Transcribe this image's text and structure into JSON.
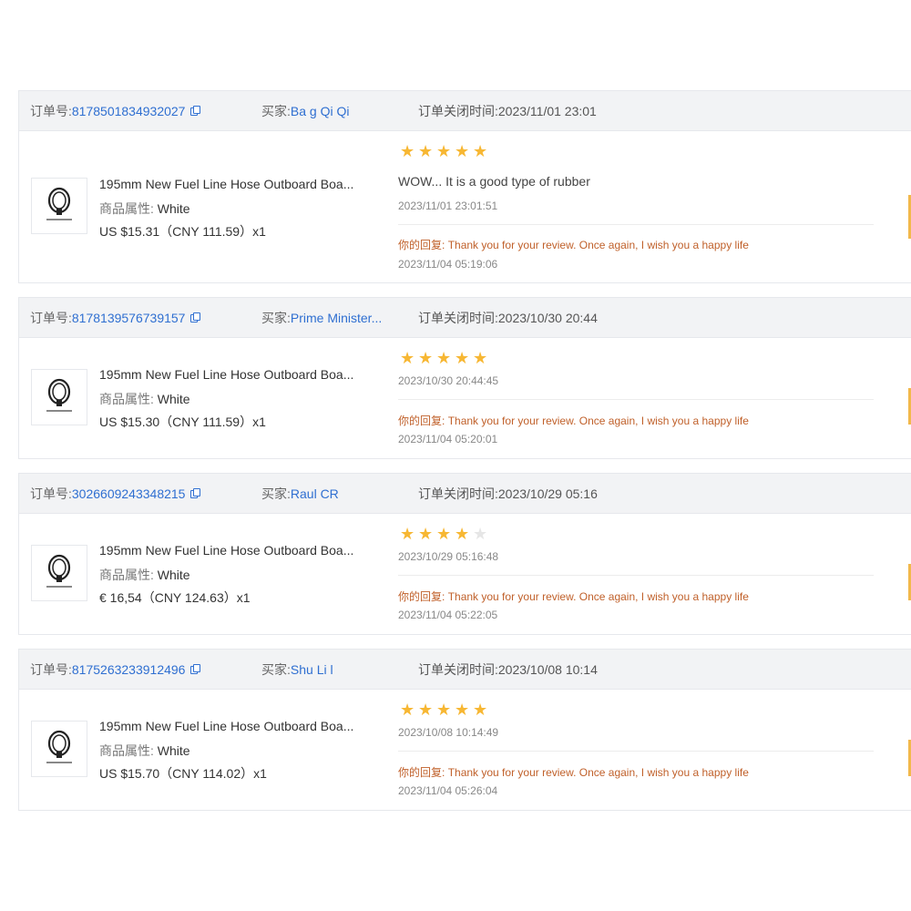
{
  "labels": {
    "order_no": "订单号:",
    "buyer": "买家:",
    "close_time": "订单关闭时间:",
    "attr": "商品属性:",
    "reply": "你的回复:"
  },
  "orders": [
    {
      "order_id": "8178501834932027",
      "buyer": "Ba g Qi Qi",
      "close_time": "2023/11/01 23:01",
      "product_title": "195mm New Fuel Line Hose Outboard Boa...",
      "attr_value": "White",
      "price": "US $15.31（CNY  111.59）x1",
      "rating": 5,
      "review_text": "WOW... It is a good type of rubber",
      "review_time": "2023/11/01 23:01:51",
      "reply_text": "Thank you for your review. Once again, I wish you a happy life",
      "reply_time": "2023/11/04 05:19:06"
    },
    {
      "order_id": "8178139576739157",
      "buyer": "Prime Minister...",
      "close_time": "2023/10/30 20:44",
      "product_title": "195mm New Fuel Line Hose Outboard Boa...",
      "attr_value": "White",
      "price": "US $15.30（CNY  111.59）x1",
      "rating": 5,
      "review_text": "",
      "review_time": "2023/10/30 20:44:45",
      "reply_text": "Thank you for your review. Once again, I wish you a happy life",
      "reply_time": "2023/11/04 05:20:01"
    },
    {
      "order_id": "3026609243348215",
      "buyer": "Raul CR",
      "close_time": "2023/10/29 05:16",
      "product_title": "195mm New Fuel Line Hose Outboard Boa...",
      "attr_value": "White",
      "price": "€ 16,54（CNY  124.63）x1",
      "rating": 4,
      "review_text": "",
      "review_time": "2023/10/29 05:16:48",
      "reply_text": "Thank you for your review. Once again, I wish you a happy life",
      "reply_time": "2023/11/04 05:22:05"
    },
    {
      "order_id": "8175263233912496",
      "buyer": "Shu Li l",
      "close_time": "2023/10/08 10:14",
      "product_title": "195mm New Fuel Line Hose Outboard Boa...",
      "attr_value": "White",
      "price": "US $15.70（CNY  114.02）x1",
      "rating": 5,
      "review_text": "",
      "review_time": "2023/10/08 10:14:49",
      "reply_text": "Thank you for your review. Once again, I wish you a happy life",
      "reply_time": "2023/11/04 05:26:04"
    }
  ],
  "icons": {
    "copy": "copy-icon",
    "star": "star-icon",
    "thumbnail": "product-thumbnail"
  },
  "colors": {
    "link": "#2f6fd1",
    "star": "#f7b733",
    "reply": "#c0602a",
    "header_bg": "#f2f3f5"
  }
}
